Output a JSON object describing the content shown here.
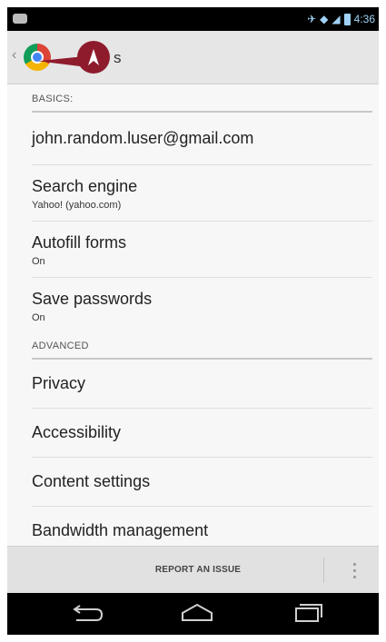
{
  "status_bar": {
    "time": "4:36"
  },
  "action_bar": {
    "title_tail": "s",
    "icon": "chrome-icon"
  },
  "sections": {
    "basics": "BASICS:",
    "advanced": "ADVANCED"
  },
  "basics_rows": [
    {
      "title": "john.random.luser@gmail.com",
      "subtitle": ""
    },
    {
      "title": "Search engine",
      "subtitle": "Yahoo! (yahoo.com)"
    },
    {
      "title": "Autofill forms",
      "subtitle": "On"
    },
    {
      "title": "Save passwords",
      "subtitle": "On"
    }
  ],
  "advanced_rows": [
    {
      "title": "Privacy"
    },
    {
      "title": "Accessibility"
    },
    {
      "title": "Content settings"
    },
    {
      "title": "Bandwidth management"
    }
  ],
  "bottom_bar": {
    "report_label": "REPORT AN ISSUE",
    "overflow_icon": "overflow-menu-icon"
  },
  "nav_bar": {
    "back_icon": "back-icon",
    "home_icon": "home-icon",
    "recents_icon": "recents-icon"
  }
}
